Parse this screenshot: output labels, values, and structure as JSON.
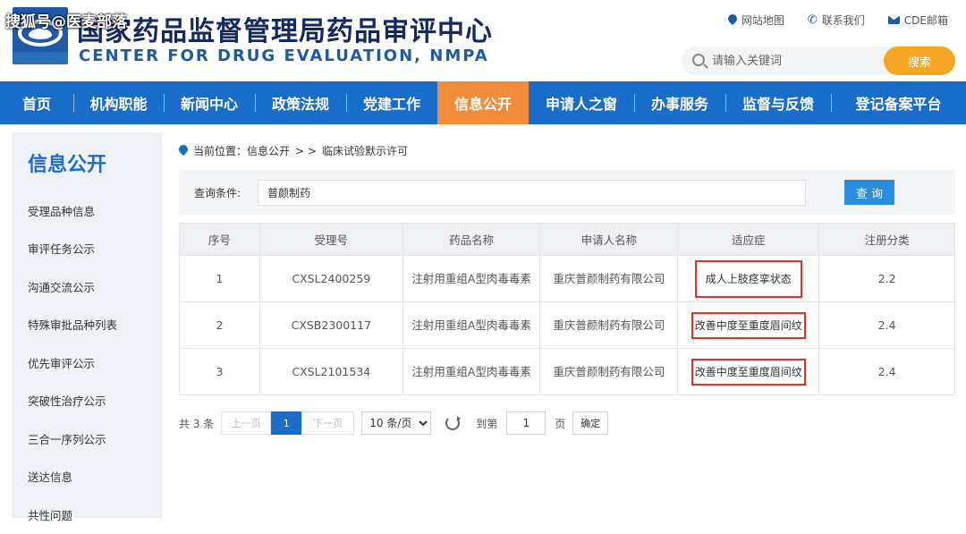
{
  "watermark": "搜狐号@医麦部落",
  "header": {
    "title_cn": "国家药品监督管理局药品审评中心",
    "title_en": "CENTER FOR DRUG EVALUATION, NMPA",
    "links": [
      "网站地图",
      "联系我们",
      "CDE邮箱"
    ],
    "search_placeholder": "请输入关键词",
    "search_button": "搜索"
  },
  "nav": {
    "items": [
      "首页",
      "机构职能",
      "新闻中心",
      "政策法规",
      "党建工作",
      "信息公开",
      "申请人之窗",
      "办事服务",
      "监督与反馈",
      "登记备案平台"
    ],
    "active_index": 5
  },
  "sidebar": {
    "title": "信息公开",
    "items": [
      "受理品种信息",
      "审评任务公示",
      "沟通交流公示",
      "特殊审批品种列表",
      "优先审评公示",
      "突破性治疗公示",
      "三合一序列公示",
      "送达信息",
      "共性问题"
    ]
  },
  "breadcrumb": {
    "label": "当前位置：信息公开",
    "sep": "> >",
    "current": "临床试验默示许可"
  },
  "query": {
    "label": "查询条件:",
    "value": "普颜制药",
    "button": "查 询"
  },
  "table": {
    "headers": [
      "序号",
      "受理号",
      "药品名称",
      "申请人名称",
      "适应症",
      "注册分类"
    ],
    "rows": [
      {
        "no": "1",
        "accept_no": "CXSL2400259",
        "drug": "注射用重组A型肉毒毒素",
        "applicant": "重庆普颜制药有限公司",
        "indication": "成人上肢痉挛状态",
        "category": "2.2"
      },
      {
        "no": "2",
        "accept_no": "CXSB2300117",
        "drug": "注射用重组A型肉毒毒素",
        "applicant": "重庆普颜制药有限公司",
        "indication": "改善中度至重度眉间纹",
        "category": "2.4"
      },
      {
        "no": "3",
        "accept_no": "CXSL2101534",
        "drug": "注射用重组A型肉毒毒素",
        "applicant": "重庆普颜制药有限公司",
        "indication": "改善中度至重度眉间纹",
        "category": "2.4"
      }
    ]
  },
  "pager": {
    "total": "共 3 条",
    "prev": "上一页",
    "current": "1",
    "next": "下一页",
    "size": "10 条/页",
    "goto_label": "到第",
    "goto_value": "1",
    "page_unit": "页",
    "confirm": "确定"
  },
  "colors": {
    "nav_bg": "#1a6cc9",
    "nav_active": "#f08c3a",
    "search_btn": "#f5a623",
    "highlight_box": "#d9362b"
  },
  "icons": [
    "map-pin-icon",
    "phone-icon",
    "mail-icon",
    "search-icon",
    "refresh-icon"
  ]
}
